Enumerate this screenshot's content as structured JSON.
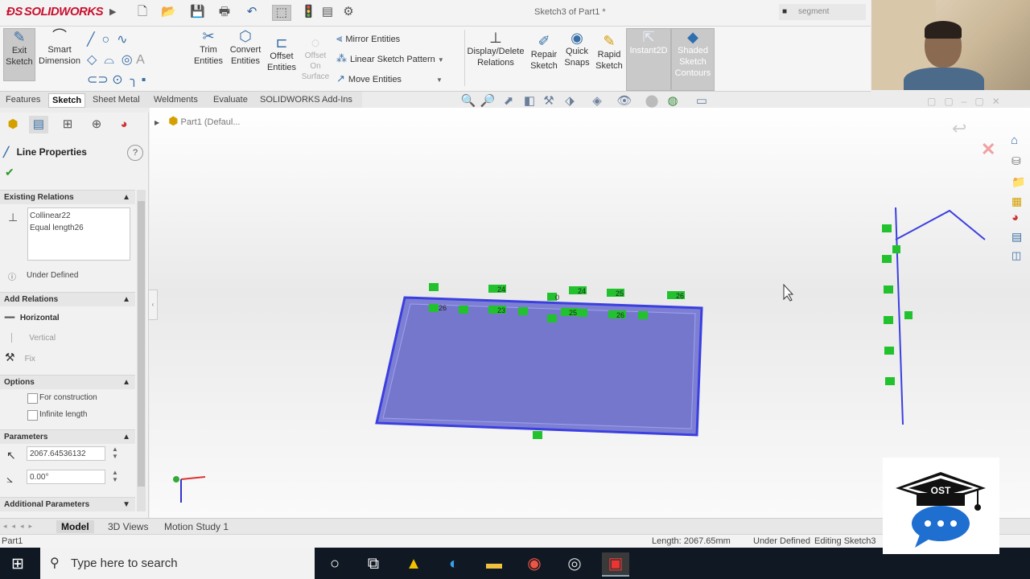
{
  "app": {
    "logo_text": "SOLIDWORKS",
    "window_title": "Sketch3 of Part1 *",
    "search_placeholder": "segment"
  },
  "ribbon": {
    "exit_sketch": [
      "Exit",
      "Sketch"
    ],
    "smart_dimension": [
      "Smart",
      "Dimension"
    ],
    "trim": [
      "Trim",
      "Entities"
    ],
    "convert": [
      "Convert",
      "Entities"
    ],
    "offset": [
      "Offset",
      "Entities"
    ],
    "offset_surface": [
      "Offset",
      "On",
      "Surface"
    ],
    "mirror": "Mirror Entities",
    "linear_pattern": "Linear Sketch Pattern",
    "move": "Move Entities",
    "display_delete": [
      "Display/Delete",
      "Relations"
    ],
    "repair": [
      "Repair",
      "Sketch"
    ],
    "quick_snaps": [
      "Quick",
      "Snaps"
    ],
    "rapid": [
      "Rapid",
      "Sketch"
    ],
    "instant2d": "Instant2D",
    "shaded": [
      "Shaded",
      "Sketch",
      "Contours"
    ]
  },
  "command_tabs": [
    "Features",
    "Sketch",
    "Sheet Metal",
    "Weldments",
    "Evaluate",
    "SOLIDWORKS Add-Ins"
  ],
  "tree": {
    "part": "Part1  (Defaul..."
  },
  "panel": {
    "title": "Line Properties",
    "existing_relations": {
      "header": "Existing Relations",
      "items": [
        "Collinear22",
        "Equal length26"
      ],
      "status": "Under Defined"
    },
    "add_relations": {
      "header": "Add Relations",
      "items": [
        "Horizontal",
        "Vertical",
        "Fix"
      ]
    },
    "options": {
      "header": "Options",
      "items": [
        "For construction",
        "Infinite length"
      ]
    },
    "parameters": {
      "header": "Parameters",
      "length": "2067.64536132",
      "angle": "0.00°"
    },
    "additional": "Additional Parameters"
  },
  "bottom_tabs": [
    "Model",
    "3D Views",
    "Motion Study 1"
  ],
  "status": {
    "left": "Part1",
    "length": "Length: 2067.65mm",
    "defined": "Under Defined",
    "editing": "Editing Sketch3"
  },
  "taskbar": {
    "search": "Type here to search"
  },
  "watermark": "OST",
  "relation_tags": {
    "top": [
      "24",
      "24",
      "25",
      "26",
      "23",
      "25",
      "26",
      "0",
      "26"
    ]
  },
  "colors": {
    "sketch_fill": "#7d7fd2",
    "sketch_line": "#3b3fe0",
    "relation_green": "#22c22e",
    "brand_red": "#c8102e"
  }
}
